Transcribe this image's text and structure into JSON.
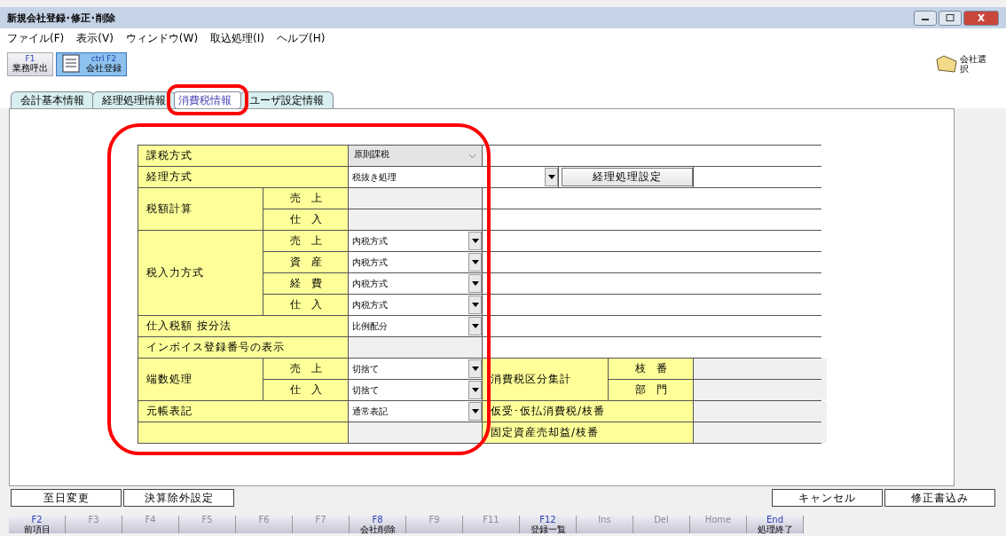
{
  "window": {
    "title": "新規会社登録･修正･削除"
  },
  "menu": [
    "ファイル(F)",
    "表示(V)",
    "ウィンドウ(W)",
    "取込処理(I)",
    "ヘルプ(H)"
  ],
  "toolbar": [
    {
      "key": "F1",
      "label": "業務呼出",
      "selected": false
    },
    {
      "key": "ctrl F2",
      "label": "会社登録",
      "selected": true
    }
  ],
  "company_button": {
    "label": "会社選択"
  },
  "tabs": [
    {
      "label": "会計基本情報",
      "selected": false,
      "highlighted": false
    },
    {
      "label": "経理処理情報",
      "selected": false,
      "highlighted": false
    },
    {
      "label": "消費税情報",
      "selected": true,
      "highlighted": true
    },
    {
      "label": "ユーザ設定情報",
      "selected": false,
      "highlighted": false
    }
  ],
  "settings": {
    "highlighted": true,
    "groups": [
      {
        "label": "課税方式",
        "value": {
          "kind": "combo",
          "text": "原則課税"
        }
      },
      {
        "label": "経理方式",
        "value": {
          "kind": "select",
          "text": "税抜き処理"
        },
        "button": "経理処理設定"
      },
      {
        "label": "税額計算",
        "rows": [
          {
            "label": "売　上",
            "value": {
              "kind": "disabled"
            }
          },
          {
            "label": "仕　入",
            "value": {
              "kind": "disabled"
            }
          }
        ]
      },
      {
        "label": "税入力方式",
        "rows": [
          {
            "label": "売　上",
            "value": {
              "kind": "select",
              "text": "内税方式"
            }
          },
          {
            "label": "資　産",
            "value": {
              "kind": "select",
              "text": "内税方式"
            }
          },
          {
            "label": "経　費",
            "value": {
              "kind": "select",
              "text": "内税方式"
            }
          },
          {
            "label": "仕　入",
            "value": {
              "kind": "select",
              "text": "内税方式"
            }
          }
        ]
      },
      {
        "label": "仕入税額 按分法",
        "value": {
          "kind": "select",
          "text": "比例配分"
        }
      },
      {
        "label": "インボイス登録番号の表示",
        "value": {
          "kind": "disabled"
        }
      },
      {
        "label": "端数処理",
        "rows": [
          {
            "label": "売　上",
            "value": {
              "kind": "select",
              "text": "切捨て"
            }
          },
          {
            "label": "仕　入",
            "value": {
              "kind": "select",
              "text": "切捨て"
            }
          }
        ]
      },
      {
        "label": "元帳表記",
        "value": {
          "kind": "select",
          "text": "通常表記"
        }
      },
      {
        "value": {
          "kind": "disabled"
        }
      }
    ],
    "side": [
      {
        "label": "消費税区分集計",
        "rows": [
          {
            "label": "枝　番"
          },
          {
            "label": "部　門"
          }
        ]
      },
      {
        "label": "仮受･仮払消費税/枝番"
      },
      {
        "label": "固定資産売却益/枝番"
      }
    ]
  },
  "left_buttons": [
    "至日変更",
    "決算除外設定"
  ],
  "right_buttons": [
    "キャンセル",
    "修正書込み"
  ],
  "function_keys": [
    {
      "key": "F2",
      "label": "前項目",
      "disabled": false
    },
    {
      "key": "F3",
      "disabled": true
    },
    {
      "key": "F4",
      "disabled": true
    },
    {
      "key": "F5",
      "disabled": true
    },
    {
      "key": "F6",
      "disabled": true
    },
    {
      "key": "F7",
      "disabled": true
    },
    {
      "key": "F8",
      "label": "会社削除",
      "disabled": false
    },
    {
      "key": "F9",
      "disabled": true
    },
    {
      "key": "F11",
      "disabled": true
    },
    {
      "key": "F12",
      "label": "登録一覧",
      "disabled": false
    },
    {
      "key": "Ins",
      "disabled": true
    },
    {
      "key": "Del",
      "disabled": true
    },
    {
      "key": "Home",
      "disabled": true
    },
    {
      "key": "End",
      "label": "処理終了",
      "disabled": false
    }
  ]
}
